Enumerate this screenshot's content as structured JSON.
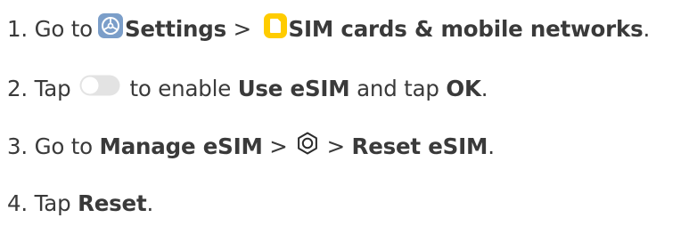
{
  "steps": [
    {
      "number": "1.",
      "go_to": "Go to",
      "settings": "Settings",
      "sep": ">",
      "sim_cards": "SIM cards & mobile networks",
      "end": "."
    },
    {
      "number": "2.",
      "tap": "Tap",
      "enable": "to enable",
      "use_esim": "Use eSIM",
      "and_tap": "and tap",
      "ok": "OK",
      "end": "."
    },
    {
      "number": "3.",
      "go_to": "Go to",
      "manage_esim": "Manage eSIM",
      "sep1": ">",
      "sep2": ">",
      "reset_esim": "Reset eSIM",
      "end": "."
    },
    {
      "number": "4.",
      "tap": "Tap",
      "reset": "Reset",
      "end": "."
    }
  ],
  "icons": {
    "settings": "settings-app-icon",
    "sim": "sim-cards-app-icon",
    "toggle": "toggle-switch-icon",
    "gear": "gear-icon"
  },
  "colors": {
    "text": "#3a3a3a",
    "settings_icon": "#7b9ec9",
    "sim_icon": "#ffcc00",
    "toggle": "#e3e3e3"
  }
}
